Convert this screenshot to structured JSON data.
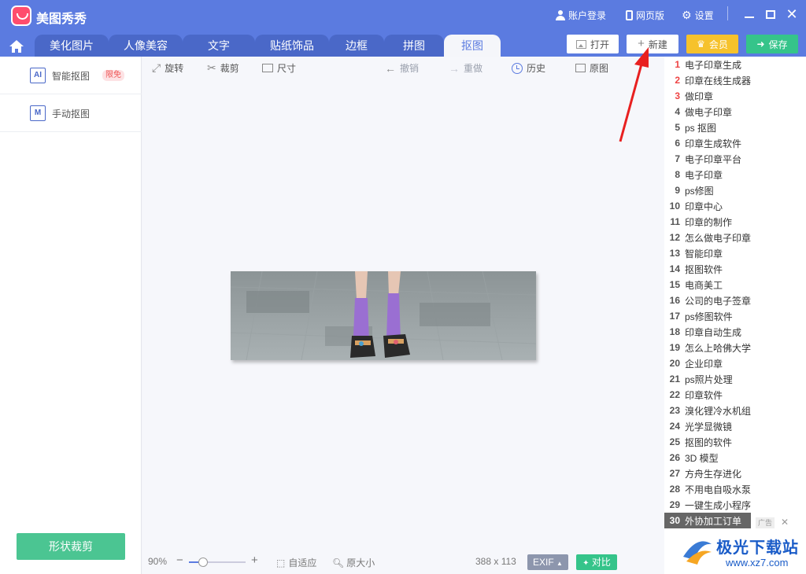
{
  "app": {
    "title": "美图秀秀"
  },
  "titlebar": {
    "login_label": "账户登录",
    "web_label": "网页版",
    "settings_label": "设置"
  },
  "tabs": [
    {
      "label": "美化图片"
    },
    {
      "label": "人像美容"
    },
    {
      "label": "文字"
    },
    {
      "label": "贴纸饰品"
    },
    {
      "label": "边框"
    },
    {
      "label": "拼图"
    },
    {
      "label": "抠图",
      "active": true
    }
  ],
  "header_buttons": {
    "open": "打开",
    "new": "新建",
    "vip": "会员",
    "save": "保存"
  },
  "sidebar": {
    "items": [
      {
        "label": "智能抠图",
        "badge": "限免",
        "icon_text": "AI"
      },
      {
        "label": "手动抠图",
        "icon_text": "M"
      }
    ],
    "shape_crop": "形状裁剪"
  },
  "toolbar": {
    "rotate": "旋转",
    "crop": "裁剪",
    "size": "尺寸",
    "undo": "撤销",
    "redo": "重做",
    "history": "历史",
    "original": "原图"
  },
  "bottom": {
    "zoom": "90%",
    "fit": "自适应",
    "original_size": "原大小",
    "dimensions": "388 x 113",
    "exif": "EXIF",
    "compare": "对比"
  },
  "ad_list": {
    "items": [
      {
        "num": "1",
        "text": "电子印章生成"
      },
      {
        "num": "2",
        "text": "印章在线生成器"
      },
      {
        "num": "3",
        "text": "做印章"
      },
      {
        "num": "4",
        "text": "做电子印章"
      },
      {
        "num": "5",
        "text": "ps 抠图"
      },
      {
        "num": "6",
        "text": "印章生成软件"
      },
      {
        "num": "7",
        "text": "电子印章平台"
      },
      {
        "num": "8",
        "text": "电子印章"
      },
      {
        "num": "9",
        "text": "ps修图"
      },
      {
        "num": "10",
        "text": "印章中心"
      },
      {
        "num": "11",
        "text": "印章的制作"
      },
      {
        "num": "12",
        "text": "怎么做电子印章"
      },
      {
        "num": "13",
        "text": "智能印章"
      },
      {
        "num": "14",
        "text": "抠图软件"
      },
      {
        "num": "15",
        "text": "电商美工"
      },
      {
        "num": "16",
        "text": "公司的电子签章"
      },
      {
        "num": "17",
        "text": "ps修图软件"
      },
      {
        "num": "18",
        "text": "印章自动生成"
      },
      {
        "num": "19",
        "text": "怎么上哈佛大学"
      },
      {
        "num": "20",
        "text": "企业印章"
      },
      {
        "num": "21",
        "text": "ps照片处理"
      },
      {
        "num": "22",
        "text": "印章软件"
      },
      {
        "num": "23",
        "text": "溴化锂冷水机组"
      },
      {
        "num": "24",
        "text": "光学显微镜"
      },
      {
        "num": "25",
        "text": "抠图的软件"
      },
      {
        "num": "26",
        "text": "3D 模型"
      },
      {
        "num": "27",
        "text": "方舟生存进化"
      },
      {
        "num": "28",
        "text": "不用电自吸水泵"
      },
      {
        "num": "29",
        "text": "一键生成小程序"
      },
      {
        "num": "30",
        "text": "外协加工订单"
      }
    ],
    "ad_tag": "广告"
  },
  "watermark": {
    "name": "极光下载站",
    "url": "www.xz7.com"
  },
  "colors": {
    "primary": "#5b7be0",
    "tab_dark": "#4a68c8",
    "save_green": "#35c48a",
    "vip_gold": "#f6c22c",
    "hot_red": "#e44444"
  }
}
